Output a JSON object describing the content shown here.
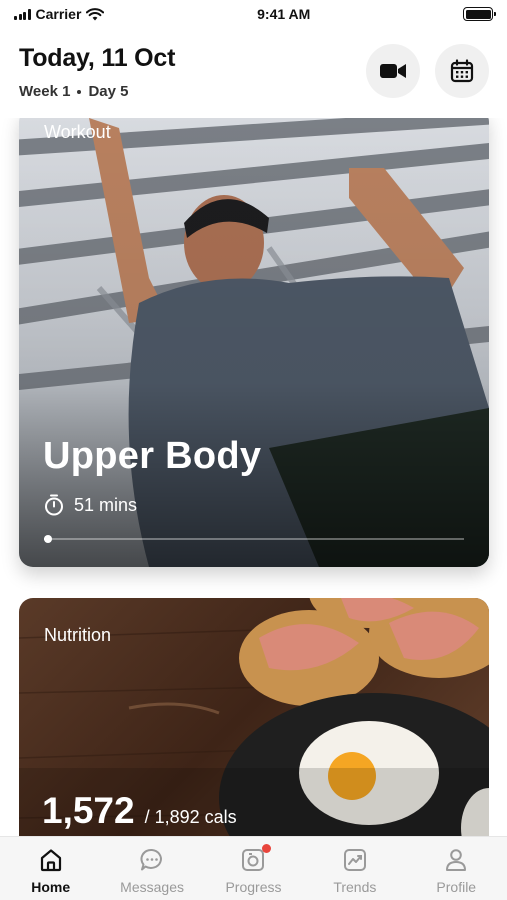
{
  "status_bar": {
    "carrier": "Carrier",
    "time": "9:41 AM"
  },
  "header": {
    "title": "Today, 11 Oct",
    "week": "Week 1",
    "day": "Day 5",
    "video_icon": "video-camera-icon",
    "calendar_icon": "calendar-icon"
  },
  "workout": {
    "label": "Workout",
    "title": "Upper Body",
    "duration": "51 mins",
    "progress": 0.01
  },
  "nutrition": {
    "label": "Nutrition",
    "calories": "1,572",
    "target": "/ 1,892 cals"
  },
  "tabs": [
    {
      "label": "Home",
      "icon": "home-icon",
      "active": true
    },
    {
      "label": "Messages",
      "icon": "chat-bubble-icon",
      "active": false
    },
    {
      "label": "Progress",
      "icon": "camera-icon",
      "active": false,
      "badge": true
    },
    {
      "label": "Trends",
      "icon": "trend-chart-icon",
      "active": false
    },
    {
      "label": "Profile",
      "icon": "user-icon",
      "active": false
    }
  ],
  "colors": {
    "badge": "#e8453c"
  }
}
